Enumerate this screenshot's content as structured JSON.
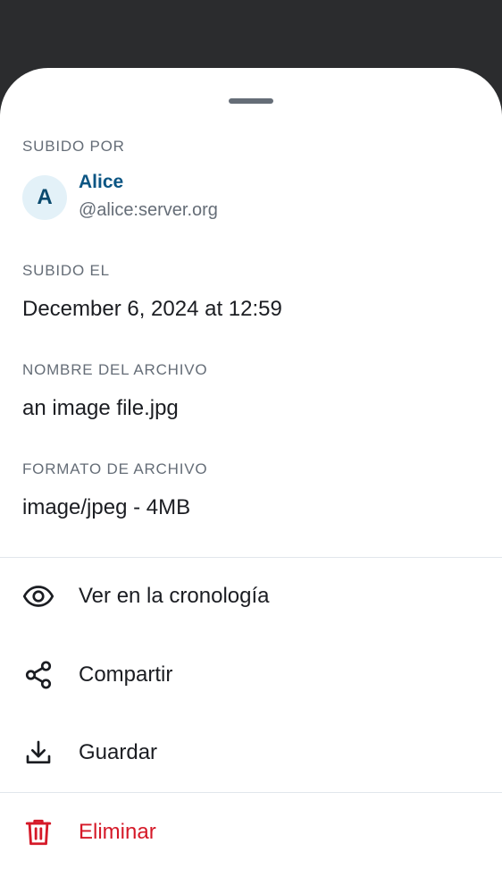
{
  "sheet": {
    "uploaded_by": {
      "label": "SUBIDO POR",
      "avatar_initial": "A",
      "name": "Alice",
      "user_id": "@alice:server.org"
    },
    "uploaded_on": {
      "label": "SUBIDO EL",
      "value": "December 6, 2024 at 12:59"
    },
    "file_name": {
      "label": "NOMBRE DEL ARCHIVO",
      "value": "an image file.jpg"
    },
    "file_format": {
      "label": "FORMATO DE ARCHIVO",
      "value": "image/jpeg - 4MB"
    },
    "actions": [
      {
        "label": "Ver en la cronología",
        "icon": "eye-icon"
      },
      {
        "label": "Compartir",
        "icon": "share-icon"
      },
      {
        "label": "Guardar",
        "icon": "download-icon"
      },
      {
        "label": "Eliminar",
        "icon": "trash-icon"
      }
    ]
  },
  "colors": {
    "backdrop": "#2b2c2e",
    "secondary_text": "#656d77",
    "primary_text": "#1b1d22",
    "user_name": "#0b5583",
    "avatar_bg": "#e3f1f8",
    "danger": "#d51928"
  }
}
